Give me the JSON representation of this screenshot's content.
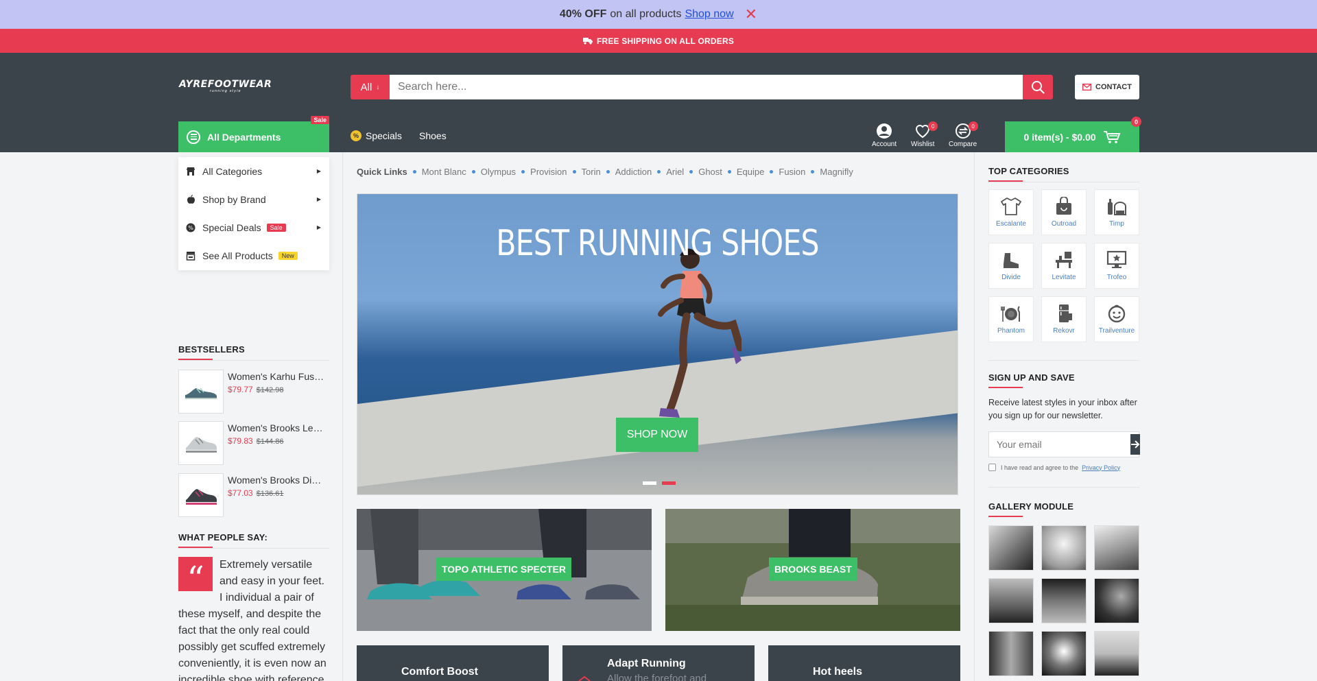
{
  "promo": {
    "bold": "40% OFF",
    "text": "on all products",
    "link": "Shop now",
    "close": "✕"
  },
  "shipping": {
    "text": "FREE SHIPPING ON ALL ORDERS"
  },
  "header": {
    "logo": "AYREFOOTWEAR",
    "logo_tagline": "running style",
    "search_category": "All",
    "search_placeholder": "Search here...",
    "contact_label": "CONTACT",
    "departments_label": "All Departments",
    "departments_tag": "Sale",
    "nav": [
      {
        "label": "Specials"
      },
      {
        "label": "Shoes"
      }
    ],
    "account_label": "Account",
    "wishlist_label": "Wishlist",
    "wishlist_count": "0",
    "compare_label": "Compare",
    "compare_count": "0",
    "cart_label": "0 item(s) - $0.00",
    "cart_count": "0"
  },
  "departments_menu": [
    {
      "label": "All Categories"
    },
    {
      "label": "Shop by Brand"
    },
    {
      "label": "Special Deals",
      "tag": "Sale"
    },
    {
      "label": "See All Products",
      "tag": "New"
    }
  ],
  "quick_links": {
    "title": "Quick Links",
    "items": [
      "Mont Blanc",
      "Olympus",
      "Provision",
      "Torin",
      "Addiction",
      "Ariel",
      "Ghost",
      "Equipe",
      "Fusion",
      "Magnifly"
    ]
  },
  "hero": {
    "headline": "BEST RUNNING SHOES",
    "button": "SHOP NOW"
  },
  "banners": [
    {
      "label": "TOPO ATHLETIC SPECTER"
    },
    {
      "label": "BROOKS BEAST"
    }
  ],
  "cards": [
    {
      "title": "Comfort Boost",
      "subtitle": ""
    },
    {
      "title": "Adapt Running",
      "subtitle": "Allow the forefoot and"
    },
    {
      "title": "Hot heels",
      "subtitle": ""
    }
  ],
  "bestsellers": {
    "title": "BESTSELLERS",
    "items": [
      {
        "name": "Women's Karhu Fusio...",
        "price": "$79.77",
        "old_price": "$142.98"
      },
      {
        "name": "Women's Brooks Levi...",
        "price": "$79.83",
        "old_price": "$144.86"
      },
      {
        "name": "Women's Brooks Divi...",
        "price": "$77.03",
        "old_price": "$136.61"
      }
    ]
  },
  "testimonial": {
    "title": "WHAT PEOPLE SAY:",
    "text": "Extremely versatile and easy in your feet. I individual a pair of these myself, and despite the fact that the only real could possibly get scuffed extremely conveniently, it is even now an incredible shoe with reference"
  },
  "top_categories": {
    "title": "TOP CATEGORIES",
    "items": [
      {
        "label": "Escalante",
        "icon": "tshirt-icon"
      },
      {
        "label": "Outroad",
        "icon": "bag-icon"
      },
      {
        "label": "Timp",
        "icon": "toiletries-icon"
      },
      {
        "label": "Divide",
        "icon": "boot-icon"
      },
      {
        "label": "Levitate",
        "icon": "furniture-icon"
      },
      {
        "label": "Trofeo",
        "icon": "monitor-icon"
      },
      {
        "label": "Phantom",
        "icon": "dining-icon"
      },
      {
        "label": "Rekovr",
        "icon": "fridge-icon"
      },
      {
        "label": "Trailventure",
        "icon": "baby-icon"
      }
    ]
  },
  "newsletter": {
    "title": "SIGN UP AND SAVE",
    "text": "Receive latest styles in your inbox after you sign up for our newsletter.",
    "placeholder": "Your email",
    "agree_text": "I have read and agree to the",
    "policy_link": "Privacy Policy"
  },
  "gallery": {
    "title": "GALLERY MODULE"
  },
  "colors": {
    "accent": "#e63b50",
    "green": "#3cbf67",
    "header": "#3b434b",
    "promo": "#c2c4f4"
  }
}
